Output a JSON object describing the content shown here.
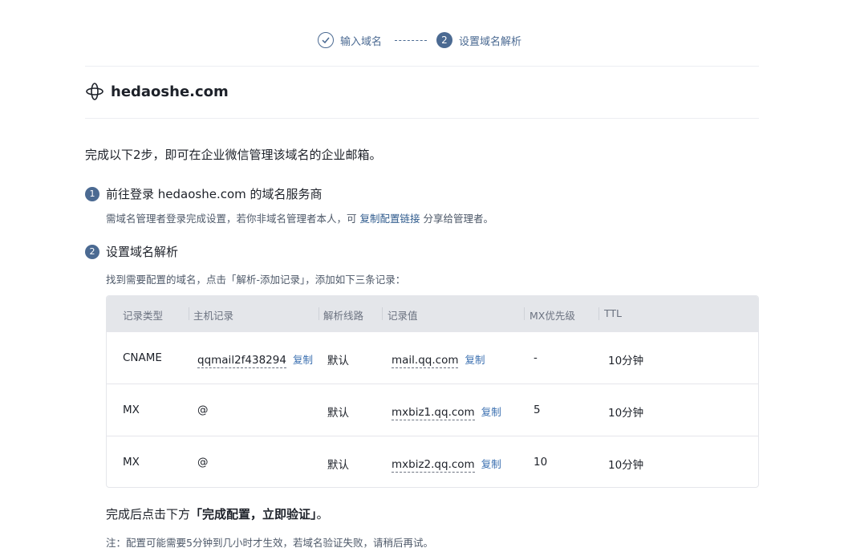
{
  "stepper": {
    "step1_label": "输入域名",
    "step2_number": "2",
    "step2_label": "设置域名解析"
  },
  "domain": {
    "name": "hedaoshe.com"
  },
  "intro": "完成以下2步，即可在企业微信管理该域名的企业邮箱。",
  "step1": {
    "number": "1",
    "title": "前往登录 hedaoshe.com 的域名服务商",
    "desc_prefix": "需域名管理者登录完成设置，若你非域名管理者本人，可 ",
    "desc_link": "复制配置链接",
    "desc_suffix": " 分享给管理者。"
  },
  "step2": {
    "number": "2",
    "title": "设置域名解析",
    "desc": "找到需要配置的域名，点击「解析-添加记录」，添加如下三条记录："
  },
  "table": {
    "headers": [
      "记录类型",
      "主机记录",
      "解析线路",
      "记录值",
      "MX优先级",
      "TTL"
    ],
    "copy_label": "复制",
    "rows": [
      {
        "type": "CNAME",
        "host": "qqmail2f438294",
        "line": "默认",
        "value": "mail.qq.com",
        "mx": "-",
        "ttl": "10分钟"
      },
      {
        "type": "MX",
        "host": "@",
        "line": "默认",
        "value": "mxbiz1.qq.com",
        "mx": "5",
        "ttl": "10分钟"
      },
      {
        "type": "MX",
        "host": "@",
        "line": "默认",
        "value": "mxbiz2.qq.com",
        "mx": "10",
        "ttl": "10分钟"
      }
    ]
  },
  "complete": {
    "prefix": "完成后点击下方",
    "highlight": "「完成配置，立即验证」",
    "suffix": "。"
  },
  "note": "注：配置可能需要5分钟到几小时才生效，若域名验证失败，请稍后再试。"
}
